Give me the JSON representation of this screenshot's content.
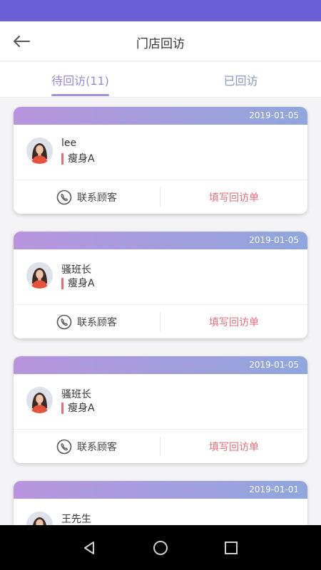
{
  "header": {
    "title": "门店回访"
  },
  "tabs": [
    {
      "label": "待回访(11)",
      "active": true
    },
    {
      "label": "已回访",
      "active": false
    }
  ],
  "cards": [
    {
      "date": "2019-01-05",
      "name": "lee",
      "service": "瘦身A",
      "contact_label": "联系顾客",
      "fill_label": "填写回访单"
    },
    {
      "date": "2019-01-05",
      "name": "骚班长",
      "service": "瘦身A",
      "contact_label": "联系顾客",
      "fill_label": "填写回访单"
    },
    {
      "date": "2019-01-05",
      "name": "骚班长",
      "service": "瘦身A",
      "contact_label": "联系顾客",
      "fill_label": "填写回访单"
    },
    {
      "date": "2019-01-01",
      "name": "王先生",
      "service": "",
      "contact_label": "",
      "fill_label": ""
    }
  ],
  "colors": {
    "status_bar": "#6a5fd6",
    "card_gradient_start": "#b894dd",
    "card_gradient_end": "#8fa6dd",
    "accent_pink": "#e26d7c",
    "tab_active": "#9a86d9"
  },
  "icons": {
    "back": "back-arrow-icon",
    "phone": "phone-icon",
    "avatar": "female-avatar-icon",
    "nav": [
      "back-triangle-icon",
      "home-circle-icon",
      "recents-square-icon"
    ]
  }
}
